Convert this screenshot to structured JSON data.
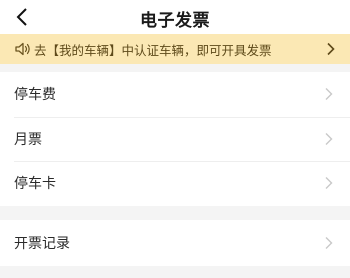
{
  "header": {
    "title": "电子发票",
    "back_icon": "chevron-left-icon"
  },
  "notice": {
    "icon": "speaker-icon",
    "text": "去【我的车辆】中认证车辆，即可开具发票",
    "arrow_icon": "chevron-right-icon"
  },
  "menu_group_1": {
    "items": [
      {
        "label": "停车费",
        "icon": "chevron-right-icon"
      },
      {
        "label": "月票",
        "icon": "chevron-right-icon"
      },
      {
        "label": "停车卡",
        "icon": "chevron-right-icon"
      }
    ]
  },
  "menu_group_2": {
    "items": [
      {
        "label": "开票记录",
        "icon": "chevron-right-icon"
      }
    ]
  },
  "colors": {
    "notice_bg": "#fbe8b4",
    "page_bg": "#f4f4f4",
    "chevron": "#c8c8c8"
  }
}
